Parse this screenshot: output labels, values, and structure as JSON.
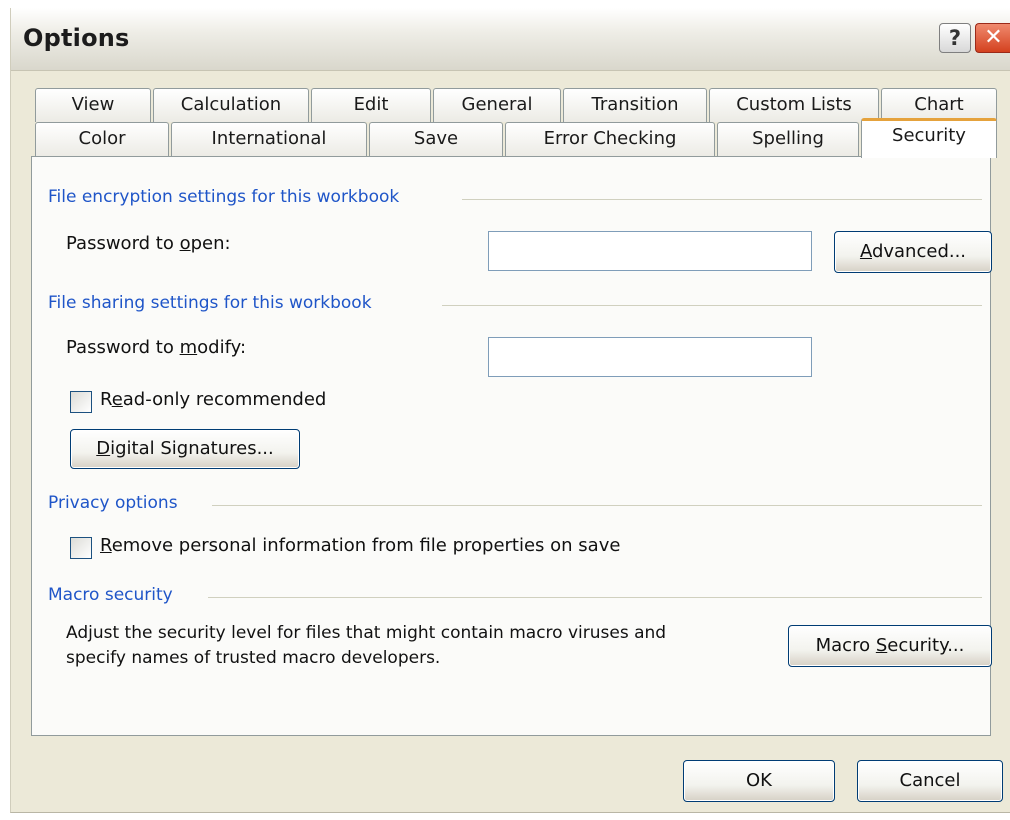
{
  "window": {
    "title": "Options",
    "help_glyph": "?",
    "close_glyph": "✕"
  },
  "tabs": {
    "row1": [
      "View",
      "Calculation",
      "Edit",
      "General",
      "Transition",
      "Custom Lists",
      "Chart"
    ],
    "row2": [
      "Color",
      "International",
      "Save",
      "Error Checking",
      "Spelling",
      "Security"
    ],
    "active": "Security"
  },
  "encryption": {
    "heading": "File encryption settings for this workbook",
    "password_open_pre": "Password to ",
    "password_open_key": "o",
    "password_open_post": "pen:",
    "password_open_value": "",
    "advanced_key": "A",
    "advanced_rest": "dvanced..."
  },
  "sharing": {
    "heading": "File sharing settings for this workbook",
    "password_modify_pre": "Password to ",
    "password_modify_key": "m",
    "password_modify_post": "odify:",
    "password_modify_value": "",
    "readonly_pre": "R",
    "readonly_key": "e",
    "readonly_post": "ad-only recommended",
    "readonly_checked": false,
    "digital_key": "D",
    "digital_rest": "igital Signatures..."
  },
  "privacy": {
    "heading": "Privacy options",
    "remove_key": "R",
    "remove_rest": "emove personal information from file properties on save",
    "remove_checked": false
  },
  "macro": {
    "heading": "Macro security",
    "description_line1": "Adjust the security level for files that might contain macro viruses and",
    "description_line2": "specify names of trusted macro developers.",
    "button_pre": "Macro ",
    "button_key": "S",
    "button_post": "ecurity..."
  },
  "footer": {
    "ok_label": "OK",
    "cancel_label": "Cancel"
  },
  "colors": {
    "dialog_bg": "#ece9d8",
    "group_heading": "#1f55c8",
    "active_tab_accent": "#e5a23c",
    "button_border": "#003c74"
  }
}
